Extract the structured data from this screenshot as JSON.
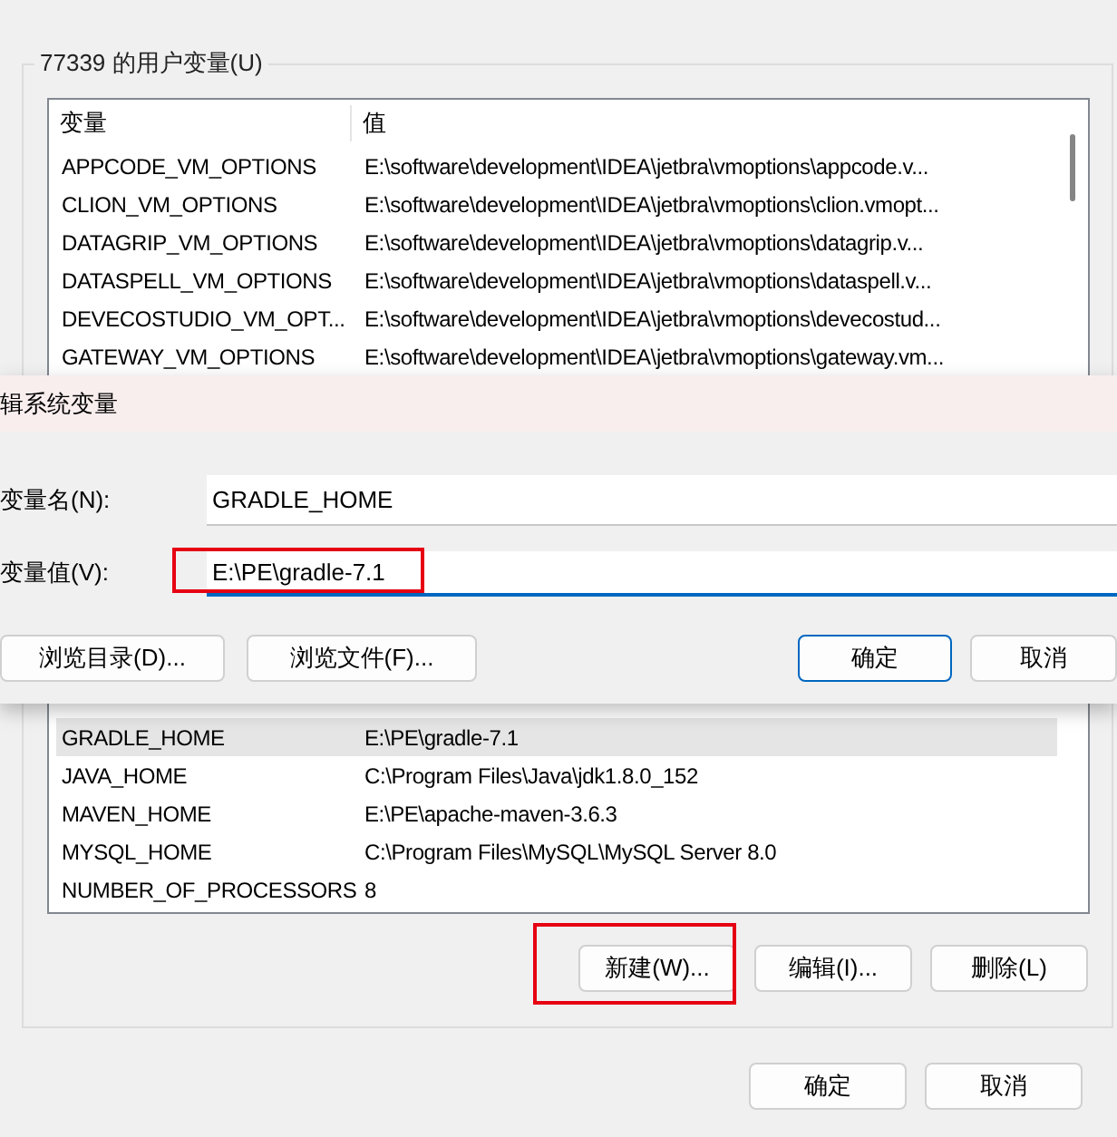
{
  "user_variables": {
    "title": "77339 的用户变量(U)",
    "columns": [
      "变量",
      "值"
    ],
    "rows_above_dialog": [
      {
        "name": "APPCODE_VM_OPTIONS",
        "value": "E:\\software\\development\\IDEA\\jetbra\\vmoptions\\appcode.v...",
        "selected": false
      },
      {
        "name": "CLION_VM_OPTIONS",
        "value": "E:\\software\\development\\IDEA\\jetbra\\vmoptions\\clion.vmopt...",
        "selected": false
      },
      {
        "name": "DATAGRIP_VM_OPTIONS",
        "value": "E:\\software\\development\\IDEA\\jetbra\\vmoptions\\datagrip.v...",
        "selected": false
      },
      {
        "name": "DATASPELL_VM_OPTIONS",
        "value": "E:\\software\\development\\IDEA\\jetbra\\vmoptions\\dataspell.v...",
        "selected": false
      },
      {
        "name": "DEVECOSTUDIO_VM_OPT...",
        "value": "E:\\software\\development\\IDEA\\jetbra\\vmoptions\\devecostud...",
        "selected": false
      },
      {
        "name": "GATEWAY_VM_OPTIONS",
        "value": "E:\\software\\development\\IDEA\\jetbra\\vmoptions\\gateway.vm...",
        "selected": false
      }
    ],
    "rows_below_dialog": [
      {
        "name": "GRADLE_HOME",
        "value": "E:\\PE\\gradle-7.1",
        "selected": true
      },
      {
        "name": "JAVA_HOME",
        "value": "C:\\Program Files\\Java\\jdk1.8.0_152",
        "selected": false
      },
      {
        "name": "MAVEN_HOME",
        "value": "E:\\PE\\apache-maven-3.6.3",
        "selected": false
      },
      {
        "name": "MYSQL_HOME",
        "value": "C:\\Program Files\\MySQL\\MySQL Server 8.0",
        "selected": false
      },
      {
        "name": "NUMBER_OF_PROCESSORS",
        "value": "8",
        "selected": false
      }
    ],
    "buttons": [
      {
        "label": "新建(W)...",
        "highlighted": true
      },
      {
        "label": "编辑(I)...",
        "highlighted": false
      },
      {
        "label": "删除(L)",
        "highlighted": false
      }
    ]
  },
  "footer_buttons": [
    "确定",
    "取消"
  ],
  "dialog": {
    "title": "辑系统变量",
    "fields": [
      {
        "label": "变量名(N):",
        "value": "GRADLE_HOME",
        "focused": false,
        "highlighted": false
      },
      {
        "label": "变量值(V):",
        "value": "E:\\PE\\gradle-7.1",
        "focused": true,
        "highlighted": true
      }
    ],
    "left_buttons": [
      "浏览目录(D)...",
      "浏览文件(F)..."
    ],
    "right_buttons": [
      {
        "label": "确定",
        "default": true
      },
      {
        "label": "取消",
        "default": false
      }
    ]
  }
}
